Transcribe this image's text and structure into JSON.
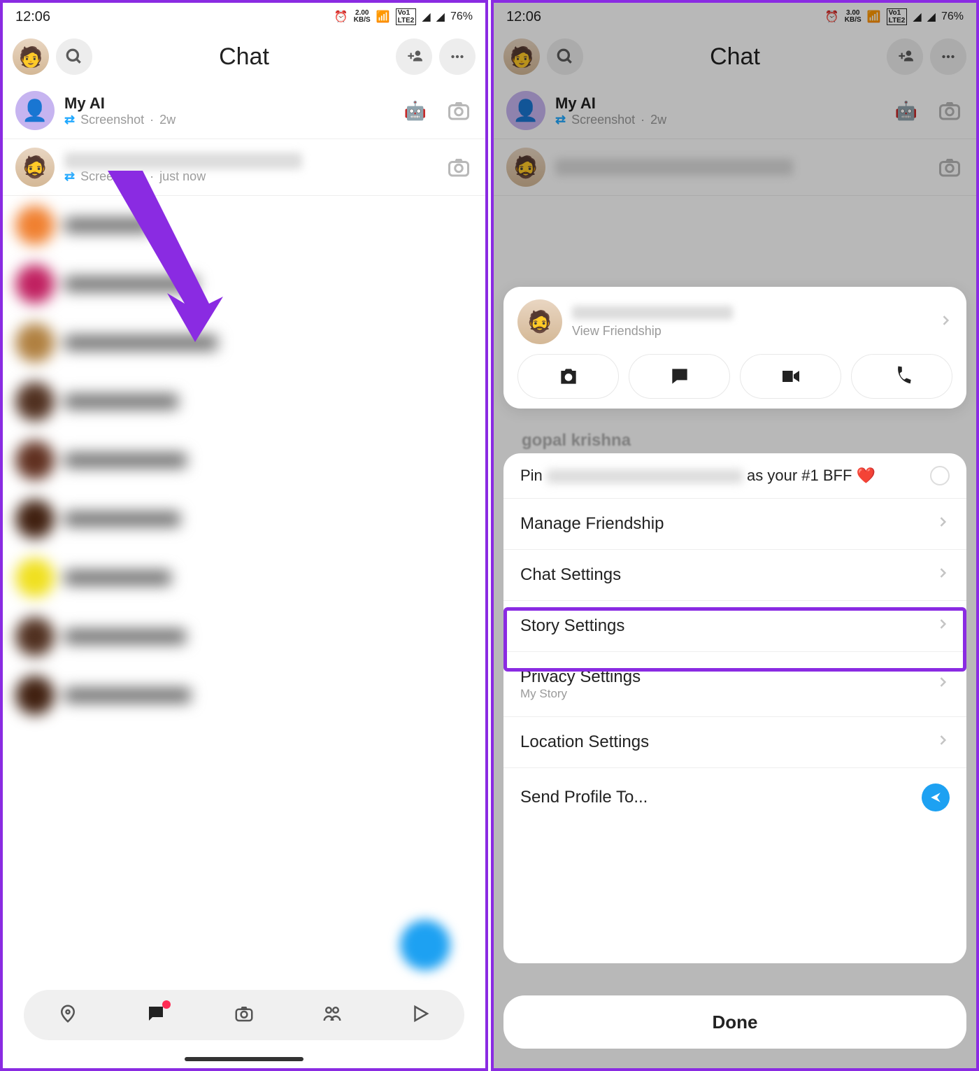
{
  "statusbar": {
    "time": "12:06",
    "net_left": "2.00",
    "net_right": "3.00",
    "kbps": "KB/S",
    "battery": "76%"
  },
  "header": {
    "title": "Chat"
  },
  "chats": [
    {
      "name": "My AI",
      "sub_label": "Screenshot",
      "sub_time": "2w",
      "emoji": "🤖"
    },
    {
      "name": "",
      "sub_label": "Screenshot",
      "sub_time": "just now",
      "emoji": ""
    }
  ],
  "blur_colors": [
    "#f08030",
    "#c02060",
    "#b08040",
    "#503020",
    "#603020",
    "#402010",
    "#f0e020",
    "#503020",
    "#402010"
  ],
  "action": {
    "view_friendship": "View Friendship"
  },
  "peek_name": "gopal krishna",
  "menu": {
    "pin_prefix": "Pin ",
    "pin_suffix": " as your #1 BFF ❤️",
    "manage": "Manage Friendship",
    "chat_settings": "Chat Settings",
    "story_settings": "Story Settings",
    "privacy": "Privacy Settings",
    "privacy_sub": "My Story",
    "location": "Location Settings",
    "send_profile": "Send Profile To..."
  },
  "done": "Done"
}
